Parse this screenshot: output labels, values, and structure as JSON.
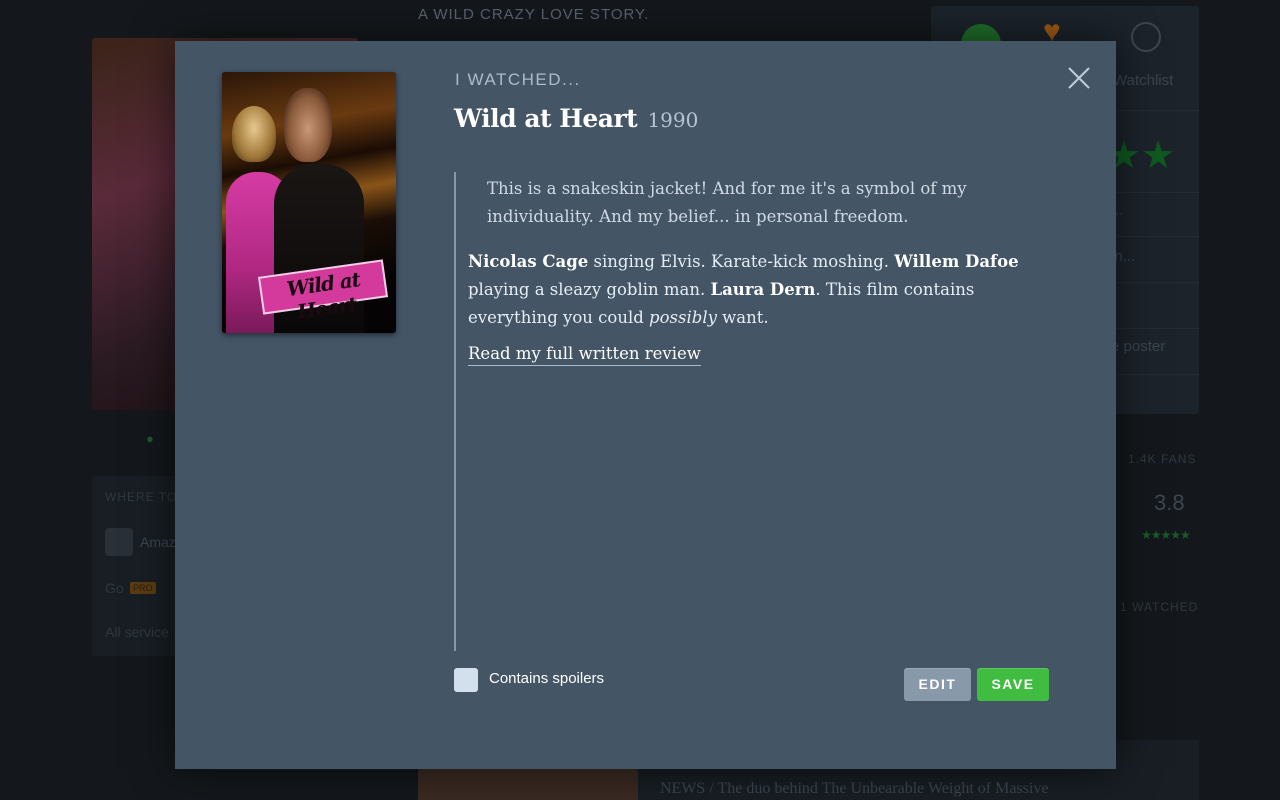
{
  "background": {
    "tagline": "A WILD CRAZY LOVE STORY.",
    "watchlist_label": "Watchlist",
    "panel_row_1": "...",
    "panel_row_2": "in...",
    "panel_row_3": "e poster",
    "fans_label": "1.4K FANS",
    "average_rating": "3.8",
    "watched_label": "1 WATCHED",
    "where_to_watch": "WHERE TO",
    "amazon": "Amaz",
    "go_label": "Go",
    "pro_badge": "PRO",
    "all_services": "All service",
    "news_label": "NEWS /",
    "news_text": "The duo behind The Unbearable Weight of Massive"
  },
  "modal": {
    "heading": "I WATCHED...",
    "film_title": "Wild at Heart",
    "film_year": "1990",
    "poster_text": "Wild at Heart",
    "review": {
      "quote": "This is a snakeskin jacket! And for me it's a symbol of my individuality. And my belief... in personal freedom.",
      "segments": [
        {
          "text": "Nicolas Cage",
          "style": "bold"
        },
        {
          "text": " singing Elvis. Karate-kick moshing. ",
          "style": "plain"
        },
        {
          "text": "Willem Dafoe",
          "style": "bold"
        },
        {
          "text": " playing a sleazy goblin man. ",
          "style": "plain"
        },
        {
          "text": "Laura Dern",
          "style": "bold"
        },
        {
          "text": ". This film contains everything you could ",
          "style": "plain"
        },
        {
          "text": "possibly",
          "style": "italic"
        },
        {
          "text": " want.",
          "style": "plain"
        }
      ],
      "link": "Read my full written review"
    },
    "spoiler_label": "Contains spoilers",
    "spoiler_checked": false,
    "edit_label": "EDIT",
    "save_label": "SAVE",
    "colors": {
      "modal_bg": "#445566",
      "save": "#40bc40",
      "edit": "#8899aa"
    }
  }
}
